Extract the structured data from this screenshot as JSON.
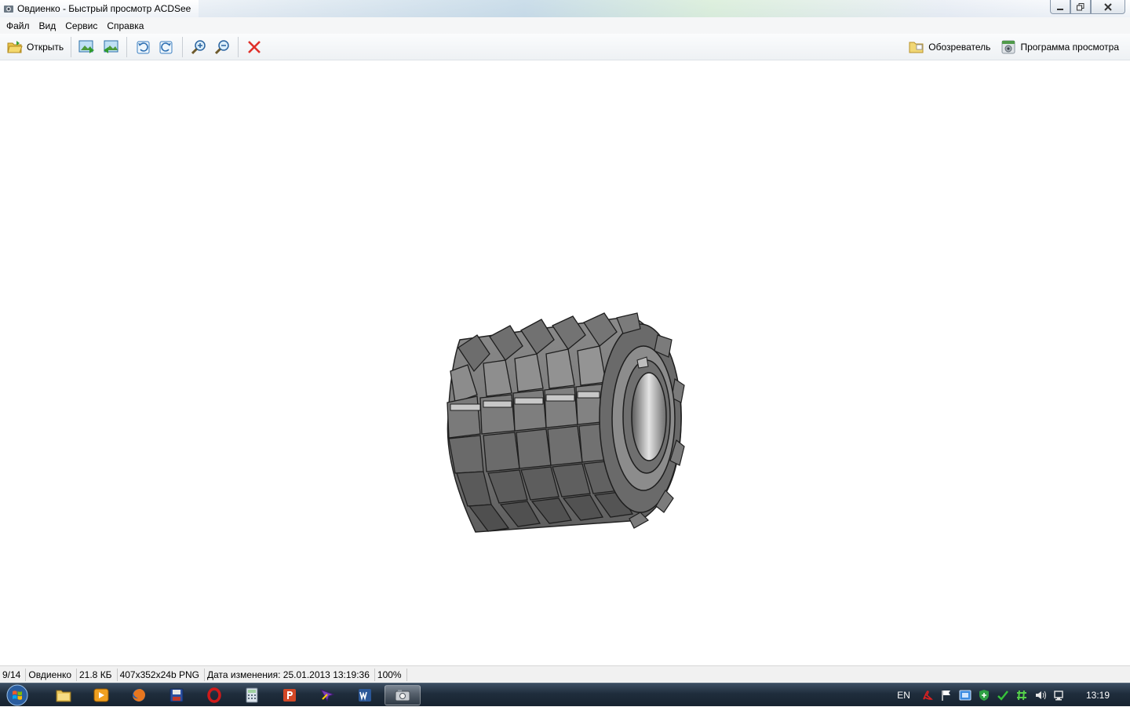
{
  "window": {
    "title": "Овдиенко - Быстрый просмотр ACDSee",
    "icon": "camera-icon",
    "controls": [
      "minimize-icon",
      "maximize-icon",
      "close-icon"
    ]
  },
  "menu": {
    "items": [
      {
        "label": "Файл"
      },
      {
        "label": "Вид"
      },
      {
        "label": "Сервис"
      },
      {
        "label": "Справка"
      }
    ]
  },
  "toolbar": {
    "open_label": "Открыть",
    "browser_label": "Обозреватель",
    "viewer_label": "Программа просмотра",
    "icons": [
      "folder-open-icon",
      "previous-image-icon",
      "next-image-icon",
      "rotate-left-icon",
      "rotate-right-icon",
      "zoom-in-icon",
      "zoom-out-icon",
      "delete-icon"
    ]
  },
  "image": {
    "subject": "gear hob cutter render"
  },
  "status": {
    "position": "9/14",
    "name": "Овдиенко",
    "size": "21.8 КБ",
    "format": "407x352x24b PNG",
    "modified": "Дата изменения: 25.01.2013 13:19:36",
    "zoom": "100%"
  },
  "taskbar": {
    "apps": [
      "explorer-icon",
      "media-player-icon",
      "firefox-icon",
      "save-disk-icon",
      "opera-icon",
      "calculator-icon",
      "powerpoint-icon",
      "app-icon",
      "word-icon",
      "acdsee-icon"
    ],
    "tray": {
      "language": "EN",
      "icons": [
        "acrobat-icon",
        "flag-icon",
        "network-drive-icon",
        "shield-icon",
        "check-icon",
        "hash-icon",
        "volume-icon",
        "network-icon"
      ],
      "time": "13:19"
    }
  }
}
